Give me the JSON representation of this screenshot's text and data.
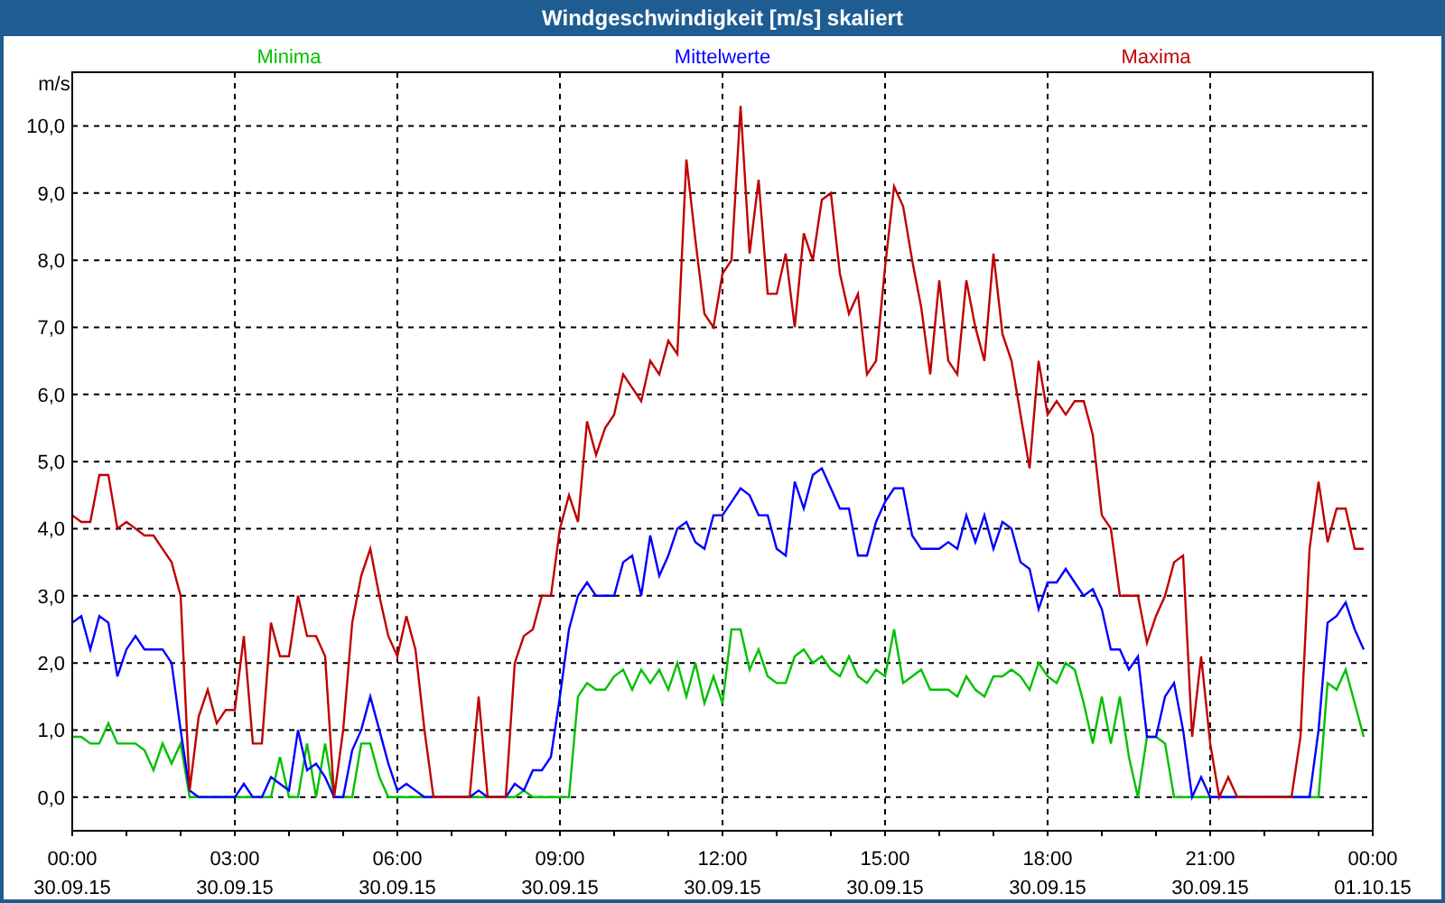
{
  "window": {
    "title": "Windgeschwindigkeit [m/s] skaliert"
  },
  "chart_data": {
    "type": "line",
    "grid": true,
    "ylabel": "m/s",
    "ylim": [
      -0.5,
      10.8
    ],
    "categories": [
      "00:00\n30.09.15",
      null,
      null,
      null,
      null,
      null,
      null,
      null,
      null,
      null,
      null,
      null,
      null,
      null,
      null,
      null,
      null,
      null,
      "03:00\n30.09.15",
      null,
      null,
      null,
      null,
      null,
      null,
      null,
      null,
      null,
      null,
      null,
      null,
      null,
      null,
      null,
      null,
      null,
      "06:00\n30.09.15",
      null,
      null,
      null,
      null,
      null,
      null,
      null,
      null,
      null,
      null,
      null,
      null,
      null,
      null,
      null,
      null,
      null,
      "09:00\n30.09.15",
      null,
      null,
      null,
      null,
      null,
      null,
      null,
      null,
      null,
      null,
      null,
      null,
      null,
      null,
      null,
      null,
      null,
      "12:00\n30.09.15",
      null,
      null,
      null,
      null,
      null,
      null,
      null,
      null,
      null,
      null,
      null,
      null,
      null,
      null,
      null,
      null,
      null,
      "15:00\n30.09.15",
      null,
      null,
      null,
      null,
      null,
      null,
      null,
      null,
      null,
      null,
      null,
      null,
      null,
      null,
      null,
      null,
      null,
      "18:00\n30.09.15",
      null,
      null,
      null,
      null,
      null,
      null,
      null,
      null,
      null,
      null,
      null,
      null,
      null,
      null,
      null,
      null,
      null,
      "21:00\n30.09.15",
      null,
      null,
      null,
      null,
      null,
      null,
      null,
      null,
      null,
      null,
      null,
      null,
      null,
      null,
      null,
      null,
      null,
      "00:00\n01.10.15"
    ],
    "yticks": [
      {
        "value": 0,
        "label": "0,0"
      },
      {
        "value": 1,
        "label": "1,0"
      },
      {
        "value": 2,
        "label": "2,0"
      },
      {
        "value": 3,
        "label": "3,0"
      },
      {
        "value": 4,
        "label": "4,0"
      },
      {
        "value": 5,
        "label": "5,0"
      },
      {
        "value": 6,
        "label": "6,0"
      },
      {
        "value": 7,
        "label": "7,0"
      },
      {
        "value": 8,
        "label": "8,0"
      },
      {
        "value": 9,
        "label": "9,0"
      },
      {
        "value": 10,
        "label": "10,0"
      }
    ],
    "series": [
      {
        "name": "Minima",
        "color": "#00c000",
        "values": [
          0.9,
          0.9,
          0.8,
          0.8,
          1.1,
          0.8,
          0.8,
          0.8,
          0.7,
          0.4,
          0.8,
          0.5,
          0.8,
          0,
          0,
          0,
          0,
          0,
          0,
          0,
          0,
          0,
          0,
          0.6,
          0,
          0,
          0.8,
          0,
          0.8,
          0,
          0,
          0,
          0.8,
          0.8,
          0.3,
          0,
          0,
          0,
          0,
          0,
          0,
          0,
          0,
          0,
          0,
          0,
          0,
          0,
          0,
          0,
          0.1,
          0,
          0,
          0,
          0,
          0,
          1.5,
          1.7,
          1.6,
          1.6,
          1.8,
          1.9,
          1.6,
          1.9,
          1.7,
          1.9,
          1.6,
          2.0,
          1.5,
          2.0,
          1.4,
          1.8,
          1.4,
          2.5,
          2.5,
          1.9,
          2.2,
          1.8,
          1.7,
          1.7,
          2.1,
          2.2,
          2.0,
          2.1,
          1.9,
          1.8,
          2.1,
          1.8,
          1.7,
          1.9,
          1.8,
          2.5,
          1.7,
          1.8,
          1.9,
          1.6,
          1.6,
          1.6,
          1.5,
          1.8,
          1.6,
          1.5,
          1.8,
          1.8,
          1.9,
          1.8,
          1.6,
          2.0,
          1.8,
          1.7,
          2.0,
          1.9,
          1.4,
          0.8,
          1.5,
          0.8,
          1.5,
          0.6,
          0,
          0.9,
          0.9,
          0.8,
          0,
          0,
          0,
          0,
          0,
          0,
          0,
          0,
          0,
          0,
          0,
          0,
          0,
          0,
          0,
          0,
          0,
          1.7,
          1.6,
          1.9,
          1.4,
          0.9,
          null
        ]
      },
      {
        "name": "Mittelwerte",
        "color": "#0000ff",
        "values": [
          2.6,
          2.7,
          2.2,
          2.7,
          2.6,
          1.8,
          2.2,
          2.4,
          2.2,
          2.2,
          2.2,
          2.0,
          1.0,
          0.1,
          0,
          0,
          0,
          0,
          0,
          0.2,
          0,
          0,
          0.3,
          0.2,
          0.1,
          1.0,
          0.4,
          0.5,
          0.3,
          0,
          0,
          0.7,
          1.0,
          1.5,
          1.0,
          0.5,
          0.1,
          0.2,
          0.1,
          0,
          0,
          0,
          0,
          0,
          0,
          0.1,
          0,
          0,
          0,
          0.2,
          0.1,
          0.4,
          0.4,
          0.6,
          1.5,
          2.5,
          3.0,
          3.2,
          3.0,
          3.0,
          3.0,
          3.5,
          3.6,
          3.0,
          3.9,
          3.3,
          3.6,
          4.0,
          4.1,
          3.8,
          3.7,
          4.2,
          4.2,
          4.4,
          4.6,
          4.5,
          4.2,
          4.2,
          3.7,
          3.6,
          4.7,
          4.3,
          4.8,
          4.9,
          4.6,
          4.3,
          4.3,
          3.6,
          3.6,
          4.1,
          4.4,
          4.6,
          4.6,
          3.9,
          3.7,
          3.7,
          3.7,
          3.8,
          3.7,
          4.2,
          3.8,
          4.2,
          3.7,
          4.1,
          4.0,
          3.5,
          3.4,
          2.8,
          3.2,
          3.2,
          3.4,
          3.2,
          3.0,
          3.1,
          2.8,
          2.2,
          2.2,
          1.9,
          2.1,
          0.9,
          0.9,
          1.5,
          1.7,
          1.0,
          0,
          0.3,
          0,
          0,
          0,
          0,
          0,
          0,
          0,
          0,
          0,
          0,
          0,
          0,
          1.0,
          2.6,
          2.7,
          2.9,
          2.5,
          2.2,
          null
        ]
      },
      {
        "name": "Maxima",
        "color": "#c00000",
        "values": [
          4.2,
          4.1,
          4.1,
          4.8,
          4.8,
          4.0,
          4.1,
          4.0,
          3.9,
          3.9,
          3.7,
          3.5,
          3.0,
          0.1,
          1.2,
          1.6,
          1.1,
          1.3,
          1.3,
          2.4,
          0.8,
          0.8,
          2.6,
          2.1,
          2.1,
          3.0,
          2.4,
          2.4,
          2.1,
          0,
          1.0,
          2.6,
          3.3,
          3.7,
          3.0,
          2.4,
          2.1,
          2.7,
          2.2,
          1.0,
          0,
          0,
          0,
          0,
          0,
          1.5,
          0,
          0,
          0,
          2.0,
          2.4,
          2.5,
          3.0,
          3.0,
          4.0,
          4.5,
          4.1,
          5.6,
          5.1,
          5.5,
          5.7,
          6.3,
          6.1,
          5.9,
          6.5,
          6.3,
          6.8,
          6.6,
          9.5,
          8.3,
          7.2,
          7.0,
          7.8,
          8.0,
          10.3,
          8.1,
          9.2,
          7.5,
          7.5,
          8.1,
          7.0,
          8.4,
          8.0,
          8.9,
          9.0,
          7.8,
          7.2,
          7.5,
          6.3,
          6.5,
          7.9,
          9.1,
          8.8,
          8.0,
          7.3,
          6.3,
          7.7,
          6.5,
          6.3,
          7.7,
          7.0,
          6.5,
          8.1,
          6.9,
          6.5,
          5.7,
          4.9,
          6.5,
          5.7,
          5.9,
          5.7,
          5.9,
          5.9,
          5.4,
          4.2,
          4.0,
          3.0,
          3.0,
          3.0,
          2.3,
          2.7,
          3.0,
          3.5,
          3.6,
          0.9,
          2.1,
          0.8,
          0,
          0.3,
          0,
          0,
          0,
          0,
          0,
          0,
          0,
          0.9,
          3.7,
          4.7,
          3.8,
          4.3,
          4.3,
          3.7,
          3.7,
          null
        ]
      }
    ]
  }
}
